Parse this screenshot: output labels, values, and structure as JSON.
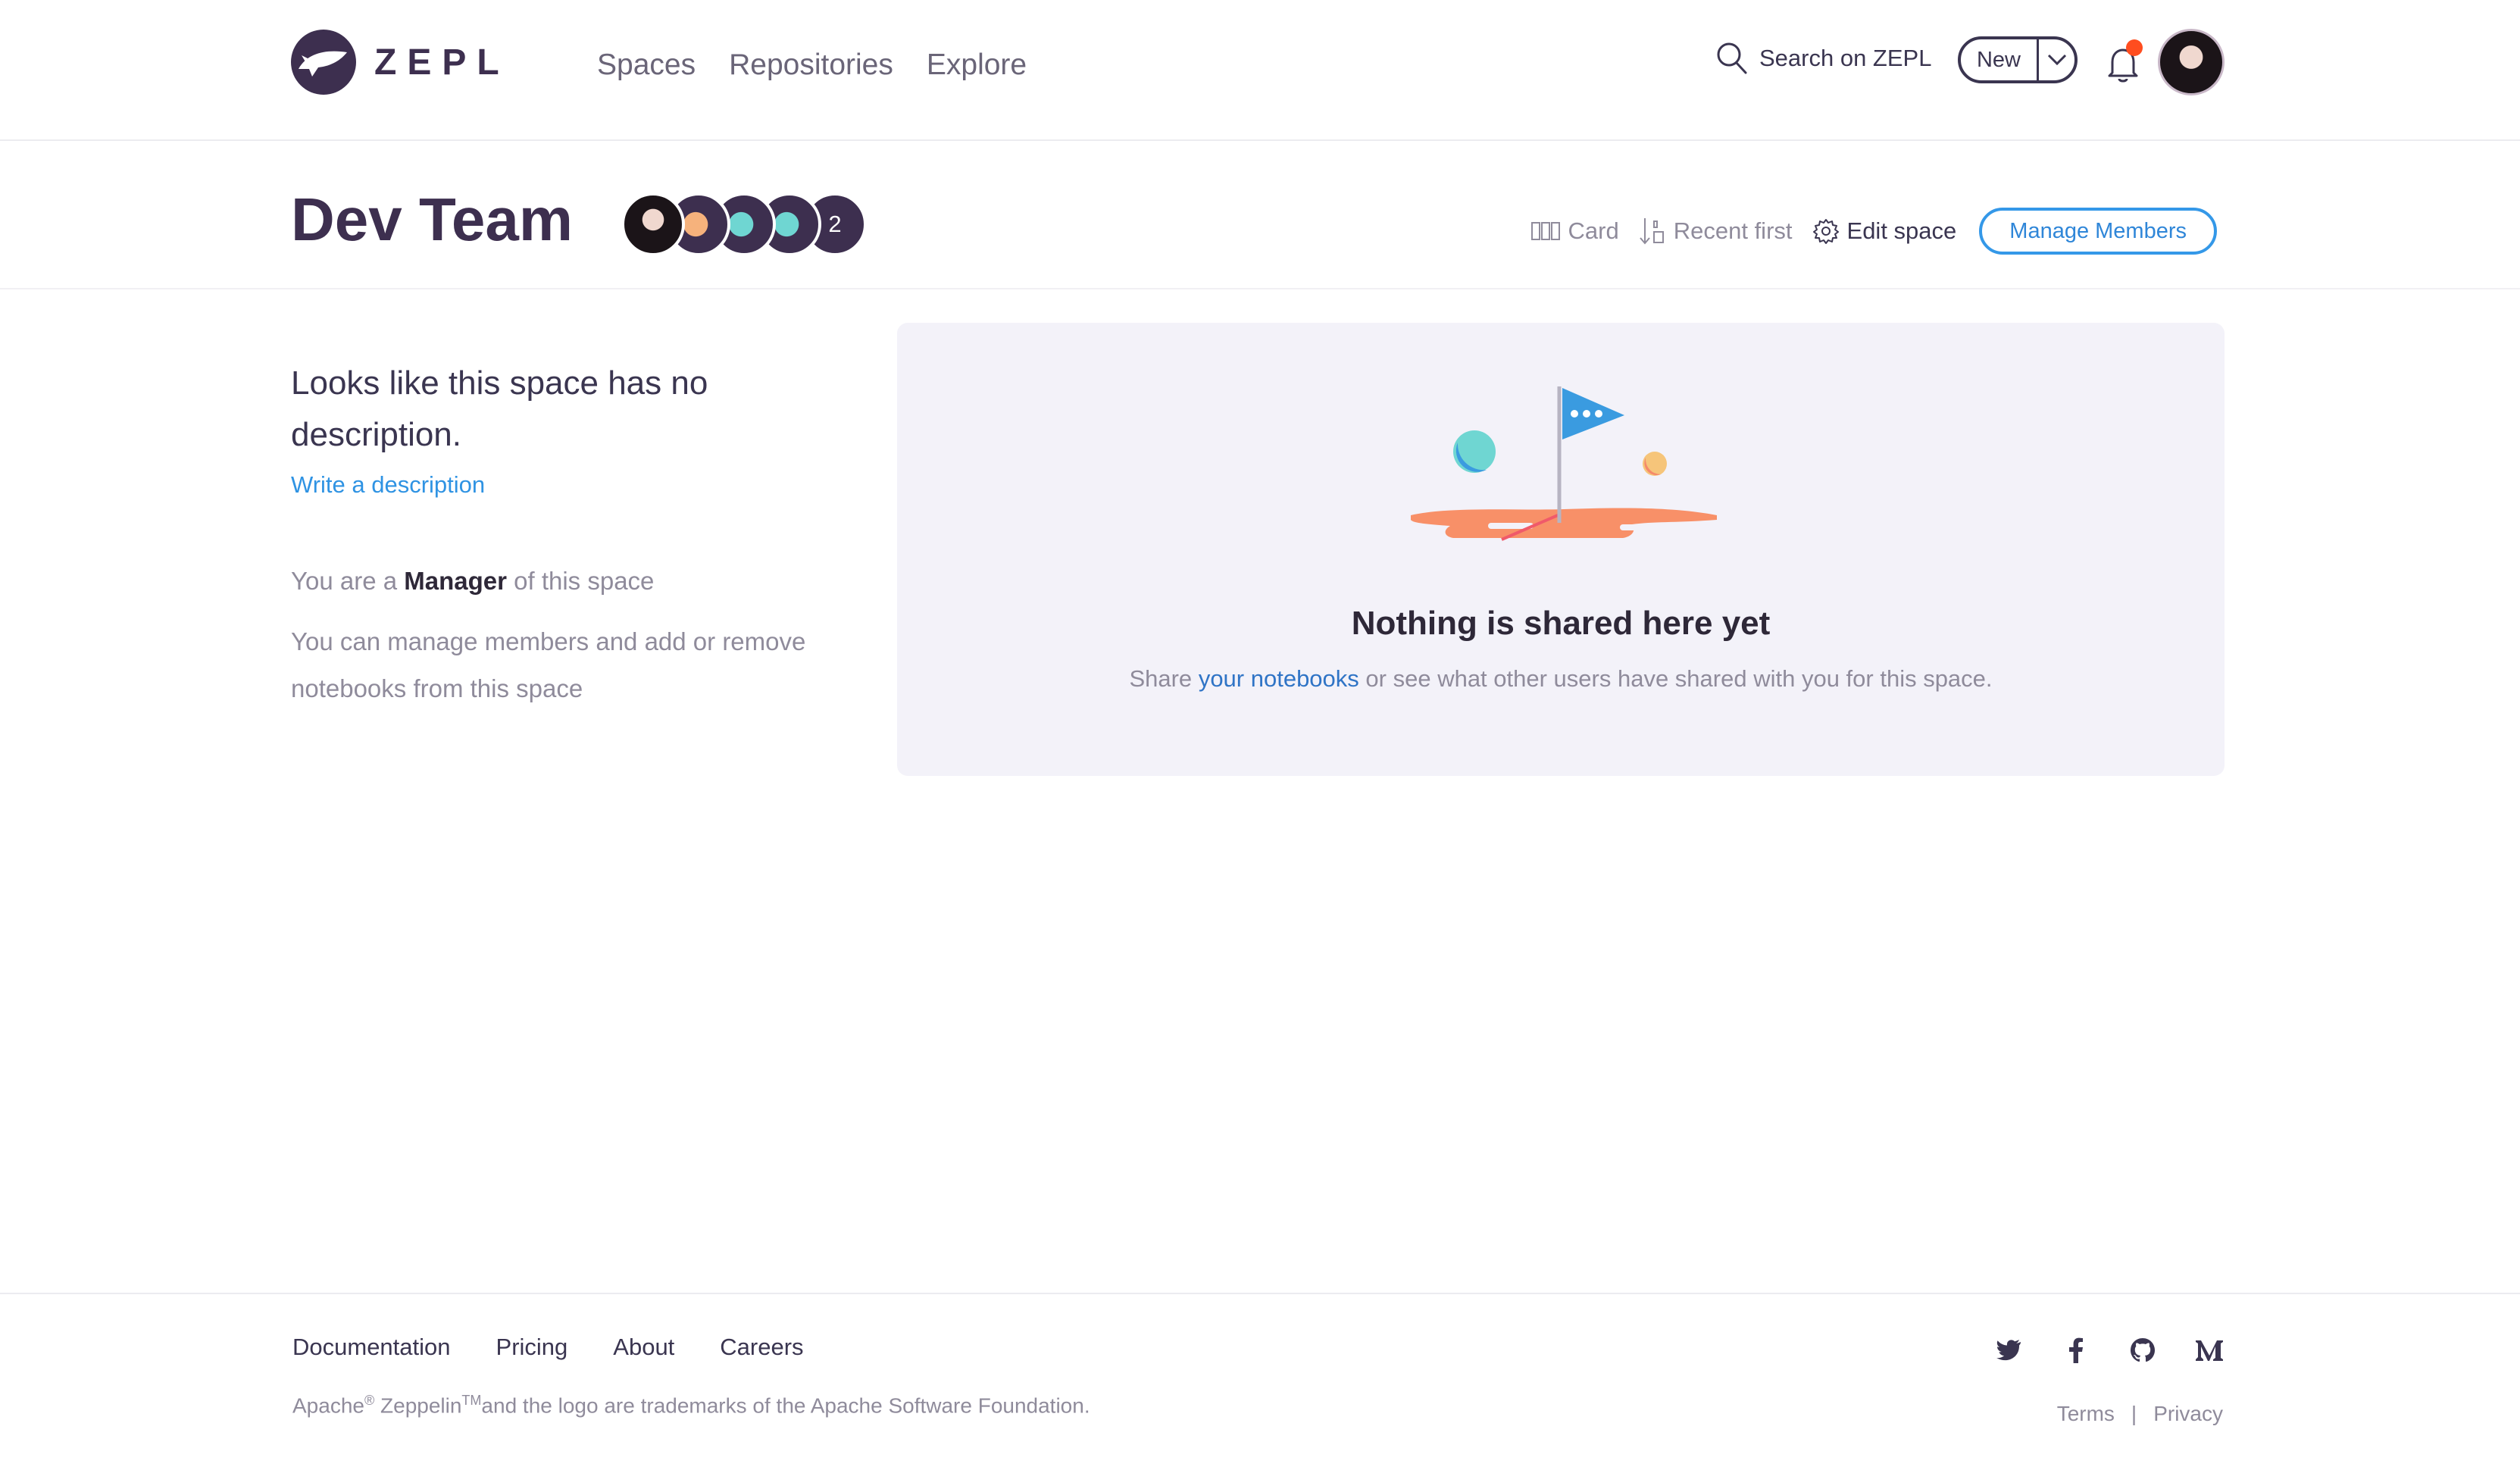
{
  "brand": {
    "name": "ZEPL"
  },
  "nav": {
    "items": [
      "Spaces",
      "Repositories",
      "Explore"
    ]
  },
  "search": {
    "label": "Search on ZEPL"
  },
  "new_button": {
    "label": "New"
  },
  "space": {
    "title": "Dev Team",
    "extra_members_count": "2"
  },
  "toolbar": {
    "view_label": "Card",
    "sort_label": "Recent first",
    "edit_label": "Edit space",
    "manage_label": "Manage Members"
  },
  "sidebar": {
    "no_description": "Looks like this space has no description.",
    "write_link": "Write a description",
    "role_prefix": "You are a",
    "role": "Manager",
    "role_suffix": "of this space",
    "role_info": "You can manage members and add or remove notebooks from this space"
  },
  "empty_state": {
    "title": "Nothing is shared here yet",
    "sub_prefix": "Share",
    "sub_link": "your notebooks",
    "sub_suffix": "or see what other users have shared with you for this space."
  },
  "footer": {
    "links": [
      "Documentation",
      "Pricing",
      "About",
      "Careers"
    ],
    "tm_apache": "Apache",
    "tm_reg": "®",
    "tm_zeppelin": "Zeppelin",
    "tm_tm": "TM",
    "tm_rest": "and the logo are trademarks of the Apache Software Foundation.",
    "terms": "Terms",
    "divider": "|",
    "privacy": "Privacy"
  },
  "colors": {
    "brand_dark": "#3d2f4f",
    "accent_blue": "#3498e8",
    "panel_bg": "#f3f2f9",
    "notification_dot": "#ff4d1f"
  }
}
